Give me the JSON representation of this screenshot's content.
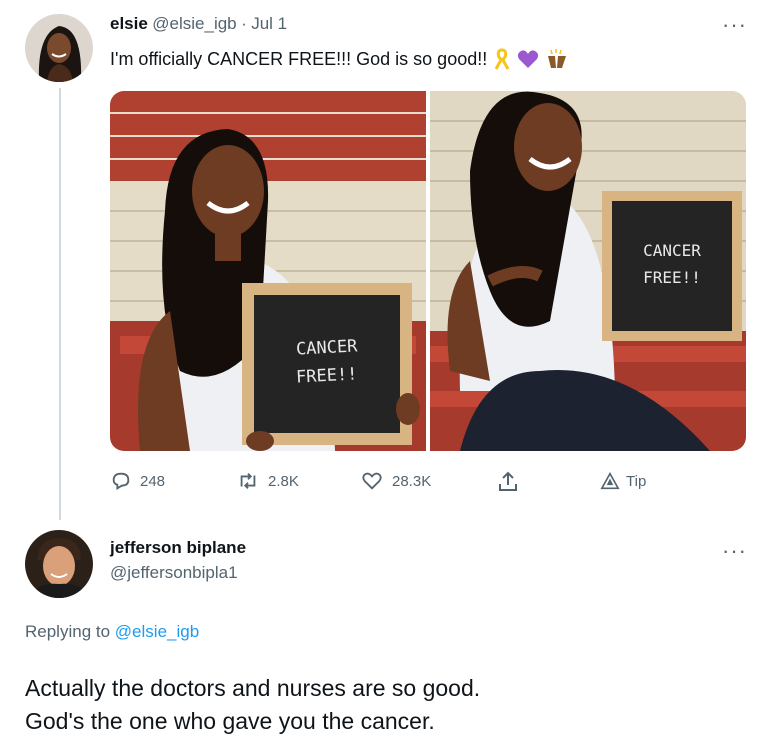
{
  "tweet": {
    "author_name": "elsie",
    "author_handle": "@elsie_igb",
    "separator": "·",
    "date": "Jul 1",
    "text": "I'm officially CANCER FREE!!! God is so good!!",
    "emoji": [
      "ribbon-emoji",
      "purple-heart-emoji",
      "raising-hands-emoji"
    ],
    "sign_text_line1": "CANCER",
    "sign_text_line2": "FREE!!",
    "actions": {
      "replies": "248",
      "retweets": "2.8K",
      "likes": "28.3K",
      "tip": "Tip"
    }
  },
  "reply": {
    "author_name": "jefferson biplane",
    "author_handle": "@jeffersonbipla1",
    "replying_prefix": "Replying to",
    "replying_handle": "@elsie_igb",
    "text_line1": "Actually the doctors and nurses are so good.",
    "text_line2": "God's the one who gave you the cancer."
  },
  "colors": {
    "text": "#0f1419",
    "muted": "#536471",
    "link": "#1d9bf0",
    "divider": "#cfd9de",
    "purple_heart": "#9b59d0",
    "ribbon": "#f5c518"
  }
}
